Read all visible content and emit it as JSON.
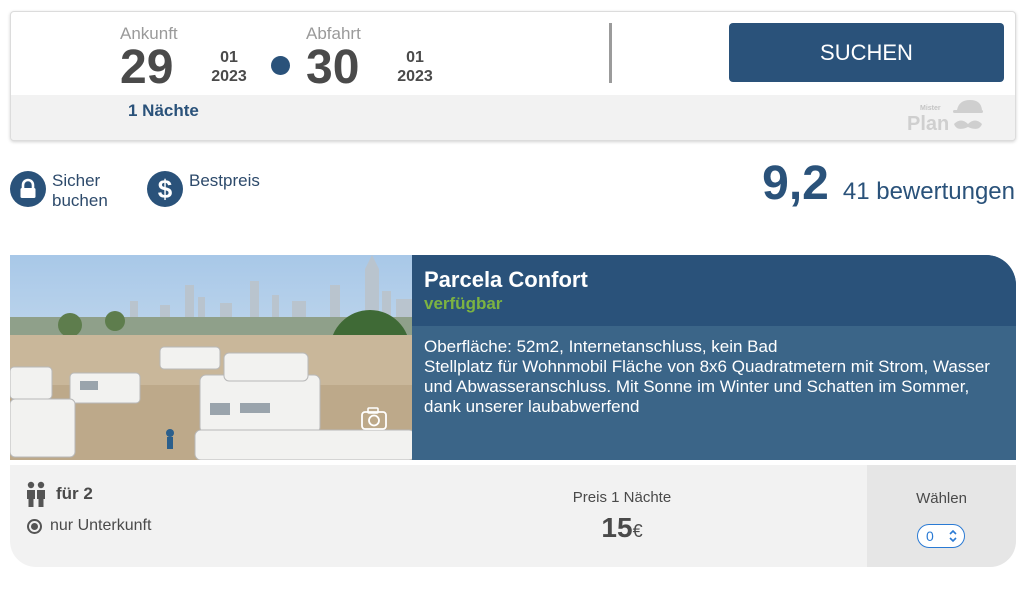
{
  "dates": {
    "arrival_label": "Ankunft",
    "arrival_day": "29",
    "arrival_month": "01",
    "arrival_year": "2023",
    "departure_label": "Abfahrt",
    "departure_day": "30",
    "departure_month": "01",
    "departure_year": "2023",
    "nights": "1 Nächte"
  },
  "search": {
    "label": "SUCHEN"
  },
  "logo": {
    "text": "Mister Plan"
  },
  "features": [
    {
      "icon": "lock-icon",
      "label_line1": "Sicher",
      "label_line2": "buchen"
    },
    {
      "icon": "dollar-icon",
      "label_line1": "Bestpreis"
    }
  ],
  "rating": {
    "score": "9,2",
    "count": "41 bewertungen"
  },
  "room": {
    "name": "Parcela Confort",
    "status": "verfügbar",
    "desc_line1": "Oberfläche: 52m2,  Internetanschluss, kein Bad",
    "desc_line2": "Stellplatz für Wohnmobil Fläche von 8x6 Quadratmetern mit Strom, Wasser und Abwasseranschluss. Mit Sonne im Winter und Schatten im Sommer, dank unserer laubabwerfend",
    "persons": "für 2",
    "board_option": "nur Unterkunft",
    "price_label": "Preis 1 Nächte",
    "price_value": "15",
    "price_currency": "€",
    "choose_label": "Wählen",
    "quantity": "0"
  },
  "colors": {
    "primary": "#2a527a",
    "info_panel": "#3b6588",
    "available": "#7cb342"
  }
}
